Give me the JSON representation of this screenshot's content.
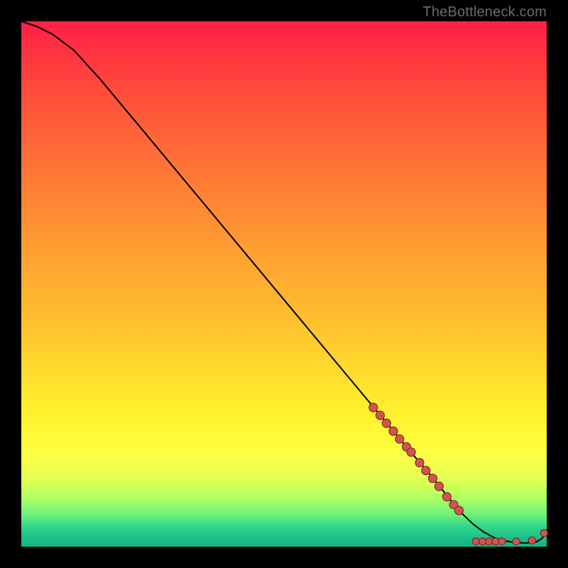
{
  "attribution": "TheBottleneck.com",
  "chart_data": {
    "type": "line",
    "title": "",
    "xlabel": "",
    "ylabel": "",
    "xlim": [
      0,
      100
    ],
    "ylim": [
      0,
      100
    ],
    "grid": false,
    "legend": false,
    "series": [
      {
        "name": "curve",
        "x": [
          0,
          3,
          6,
          10,
          15,
          20,
          25,
          30,
          35,
          40,
          45,
          50,
          55,
          60,
          65,
          70,
          75,
          78,
          80,
          82,
          84,
          86,
          88,
          90,
          92,
          94,
          96,
          98,
          99,
          100
        ],
        "y": [
          100,
          99,
          97.5,
          94.5,
          89,
          83,
          77,
          71,
          65,
          59,
          53,
          47,
          41,
          35,
          29,
          23,
          17,
          13.5,
          11,
          8.5,
          6.2,
          4.3,
          2.8,
          1.7,
          1.1,
          0.8,
          0.7,
          0.9,
          1.5,
          2.6
        ]
      }
    ],
    "markers": [
      {
        "x": 67.0,
        "y": 26.5,
        "r": 6
      },
      {
        "x": 68.3,
        "y": 25.0,
        "r": 6
      },
      {
        "x": 69.5,
        "y": 23.5,
        "r": 6
      },
      {
        "x": 70.8,
        "y": 22.0,
        "r": 6
      },
      {
        "x": 72.0,
        "y": 20.5,
        "r": 6
      },
      {
        "x": 73.3,
        "y": 19.0,
        "r": 6
      },
      {
        "x": 74.2,
        "y": 18.0,
        "r": 6
      },
      {
        "x": 75.8,
        "y": 16.0,
        "r": 6
      },
      {
        "x": 77.0,
        "y": 14.5,
        "r": 6
      },
      {
        "x": 78.3,
        "y": 13.0,
        "r": 6
      },
      {
        "x": 79.5,
        "y": 11.5,
        "r": 6
      },
      {
        "x": 81.0,
        "y": 9.5,
        "r": 6
      },
      {
        "x": 82.3,
        "y": 8.0,
        "r": 6
      },
      {
        "x": 83.3,
        "y": 6.9,
        "r": 6
      },
      {
        "x": 86.5,
        "y": 1.0,
        "r": 5
      },
      {
        "x": 87.8,
        "y": 1.0,
        "r": 5
      },
      {
        "x": 89.0,
        "y": 1.0,
        "r": 5
      },
      {
        "x": 90.3,
        "y": 1.0,
        "r": 5
      },
      {
        "x": 91.5,
        "y": 1.0,
        "r": 5
      },
      {
        "x": 94.2,
        "y": 1.0,
        "r": 5
      },
      {
        "x": 97.2,
        "y": 1.2,
        "r": 5
      },
      {
        "x": 99.5,
        "y": 2.6,
        "r": 5
      }
    ]
  }
}
